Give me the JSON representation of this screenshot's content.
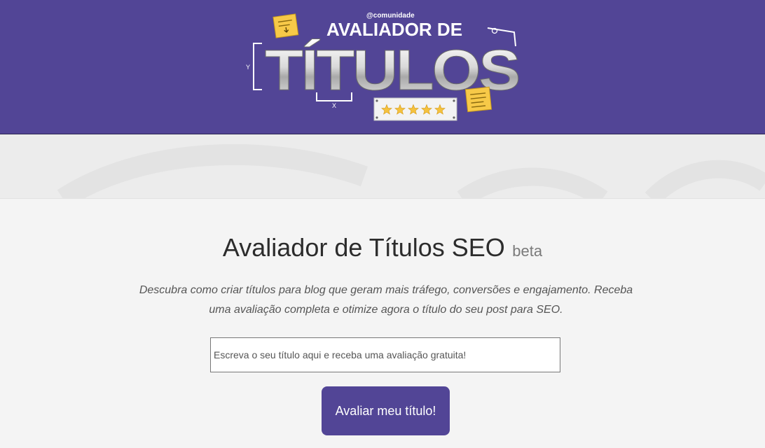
{
  "header": {
    "logo": {
      "community_tag": "@comunidade",
      "line1": "AVALIADOR DE",
      "line2": "TÍTULOS",
      "axis_y": "Y",
      "axis_x": "X",
      "stars": 5
    }
  },
  "main": {
    "title": "Avaliador de Títulos SEO",
    "badge": "beta",
    "description": "Descubra como criar títulos para blog que geram mais tráfego, conversões e engajamento. Receba uma avaliação completa e otimize agora o título do seu post para SEO.",
    "input": {
      "value": "",
      "placeholder": "Escreva o seu título aqui e receba uma avaliação gratuita!"
    },
    "submit_label": "Avaliar meu título!"
  },
  "colors": {
    "brand": "#524596",
    "star": "#f5c23e",
    "note": "#f7c948"
  }
}
